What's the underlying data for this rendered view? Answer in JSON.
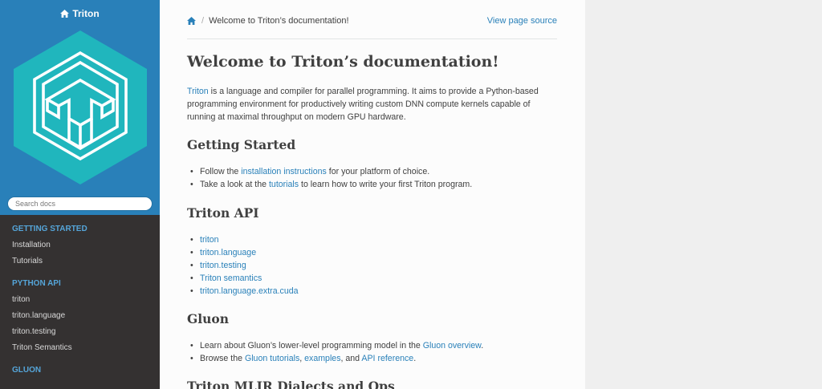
{
  "sidebar": {
    "brand": "Triton",
    "search_placeholder": "Search docs",
    "sections": [
      {
        "caption": "Getting Started",
        "items": [
          "Installation",
          "Tutorials"
        ]
      },
      {
        "caption": "Python API",
        "items": [
          "triton",
          "triton.language",
          "triton.testing",
          "Triton Semantics"
        ]
      },
      {
        "caption": "Gluon",
        "items": []
      }
    ]
  },
  "breadcrumb": {
    "home_icon": "home-icon",
    "separator": "/",
    "current": "Welcome to Triton’s documentation!",
    "view_source": "View page source"
  },
  "main": {
    "title": "Welcome to Triton’s documentation!",
    "intro_link": "Triton",
    "intro_text": " is a language and compiler for parallel programming. It aims to provide a Python-based programming environment for productively writing custom DNN compute kernels capable of running at maximal throughput on modern GPU hardware.",
    "getting_started": {
      "heading": "Getting Started",
      "b1_pre": "Follow the ",
      "b1_link": "installation instructions",
      "b1_post": " for your platform of choice.",
      "b2_pre": "Take a look at the ",
      "b2_link": "tutorials",
      "b2_post": " to learn how to write your first Triton program."
    },
    "triton_api": {
      "heading": "Triton API",
      "links": [
        "triton",
        "triton.language",
        "triton.testing",
        "Triton semantics",
        "triton.language.extra.cuda"
      ]
    },
    "gluon": {
      "heading": "Gluon",
      "b1_pre": "Learn about Gluon’s lower-level programming model in the ",
      "b1_link": "Gluon overview",
      "b1_post": ".",
      "b2_pre": "Browse the ",
      "b2_link1": "Gluon tutorials",
      "b2_sep": ", ",
      "b2_link2": "examples",
      "b2_and": ", and ",
      "b2_link3": "API reference",
      "b2_post": "."
    },
    "mlir_heading": "Triton MLIR Dialects and Ops"
  },
  "colors": {
    "sidebar_top": "#2980b9",
    "sidebar_bg": "#343131",
    "caption": "#55a5d9",
    "link": "#2980b9",
    "logo_hex": "#20b6bd"
  }
}
